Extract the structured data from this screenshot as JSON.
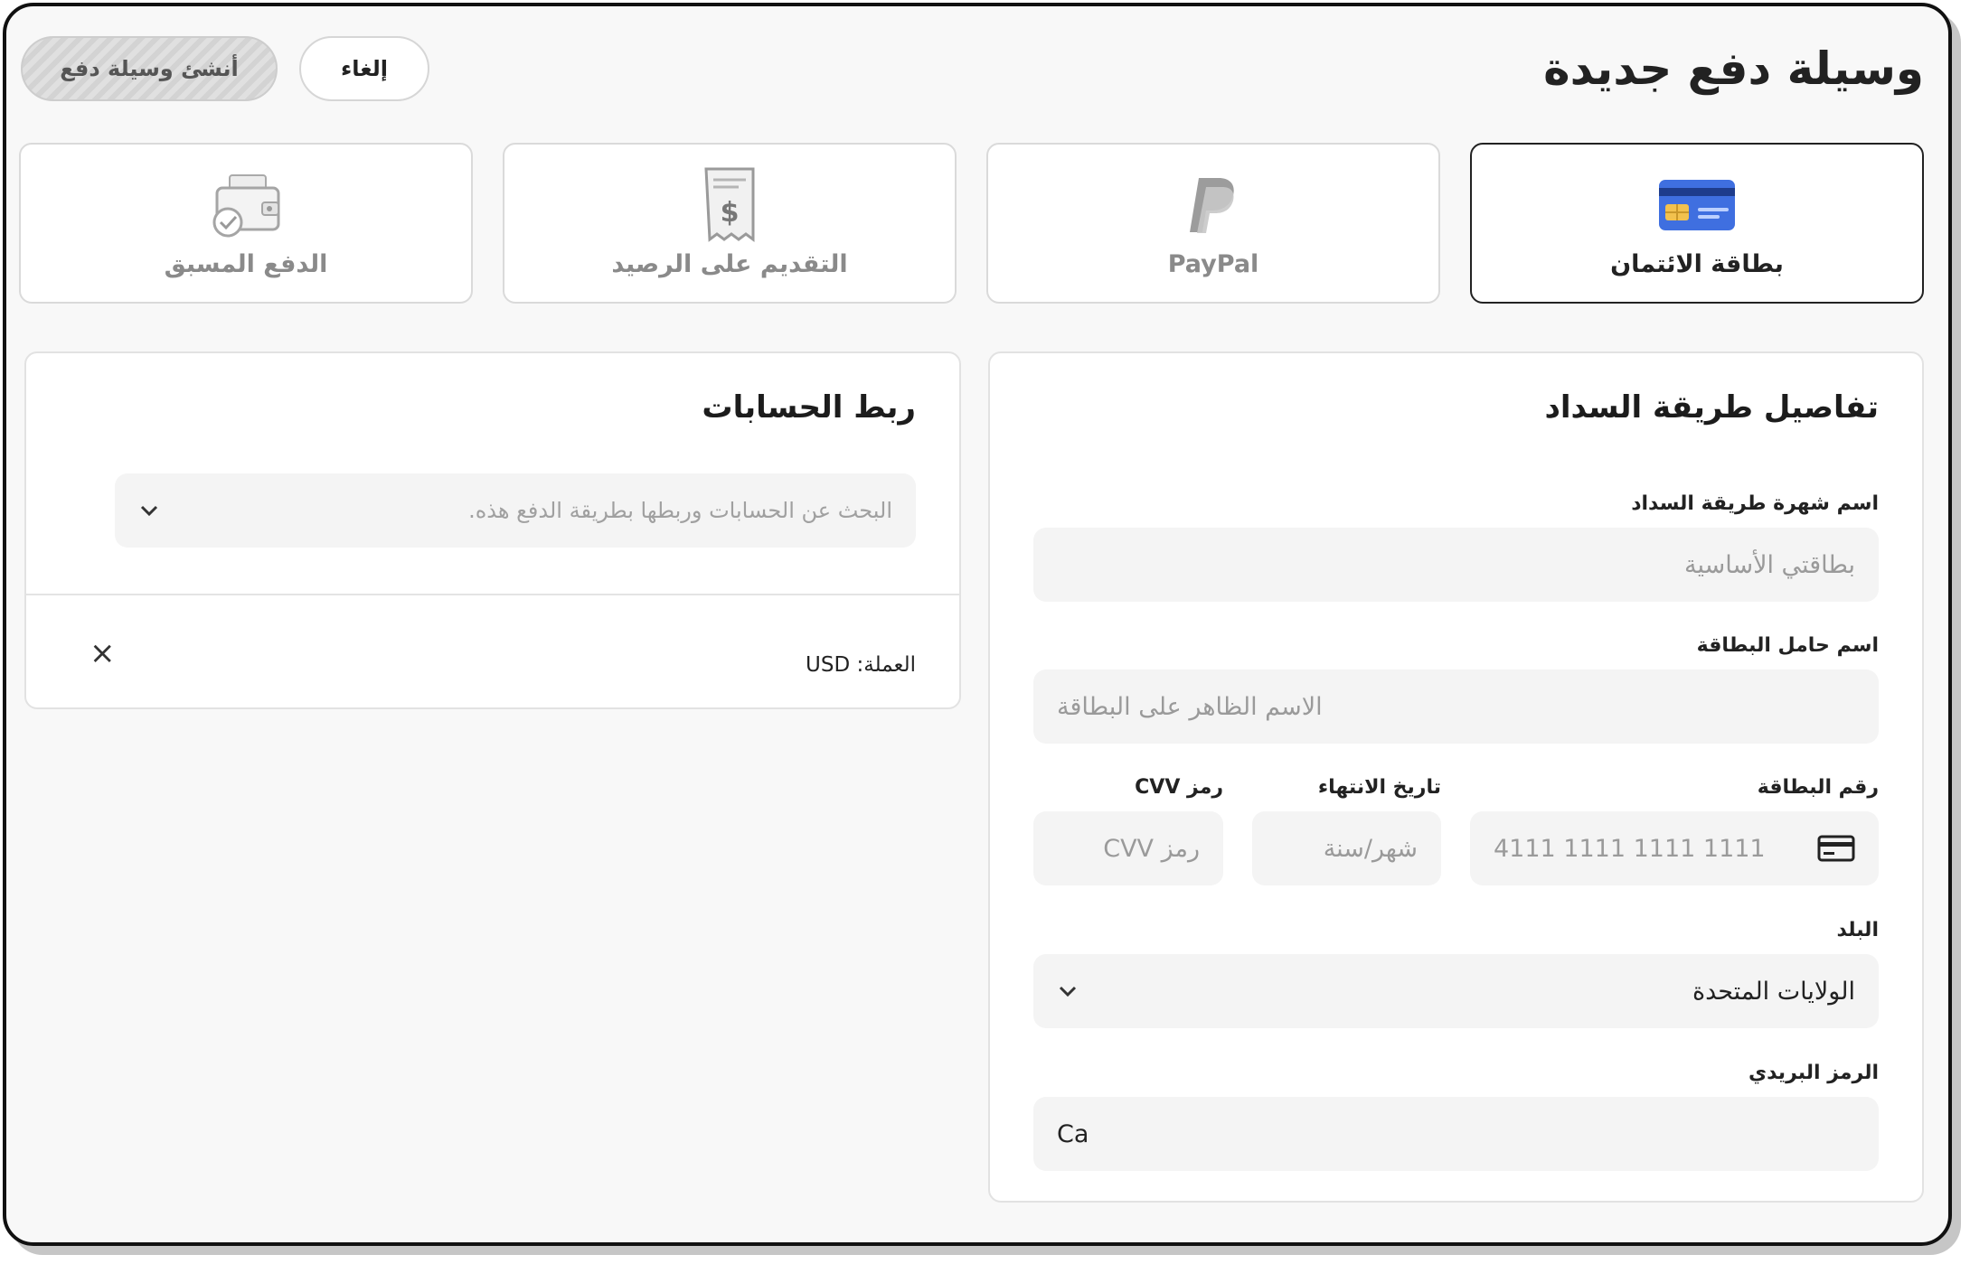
{
  "header": {
    "title": "وسيلة دفع جديدة",
    "cancel_label": "إلغاء",
    "create_label": "أنشئ وسيلة دفع"
  },
  "methods": [
    {
      "label": "بطاقة الائتمان",
      "icon": "credit-card-icon",
      "selected": true
    },
    {
      "label": "PayPal",
      "icon": "paypal-icon",
      "selected": false
    },
    {
      "label": "التقديم على الرصيد",
      "icon": "receipt-dollar-icon",
      "selected": false
    },
    {
      "label": "الدفع المسبق",
      "icon": "wallet-check-icon",
      "selected": false
    }
  ],
  "details": {
    "title": "تفاصيل طريقة السداد",
    "nickname_label": "اسم شهرة طريقة السداد",
    "nickname_placeholder": "بطاقتي الأساسية",
    "holder_label": "اسم حامل البطاقة",
    "holder_placeholder": "الاسم الظاهر على البطاقة",
    "number_label": "رقم البطاقة",
    "number_placeholder": "4111 1111 1111 1111",
    "expiry_label": "تاريخ الانتهاء",
    "expiry_placeholder": "شهر/سنة",
    "cvv_label": "رمز CVV",
    "cvv_placeholder": "رمز CVV",
    "country_label": "البلد",
    "country_value": "الولايات المتحدة",
    "zip_label": "الرمز البريدي",
    "zip_value": "Ca"
  },
  "accounts": {
    "title": "ربط الحسابات",
    "search_placeholder": "البحث عن الحسابات وربطها بطريقة الدفع هذه.",
    "currency_text": "العملة: USD",
    "close_icon": "×"
  },
  "colors": {
    "accent_card": "#3f6fe0",
    "chip": "#f2c14e",
    "tile_icon_gray": "#a8a8a8"
  }
}
